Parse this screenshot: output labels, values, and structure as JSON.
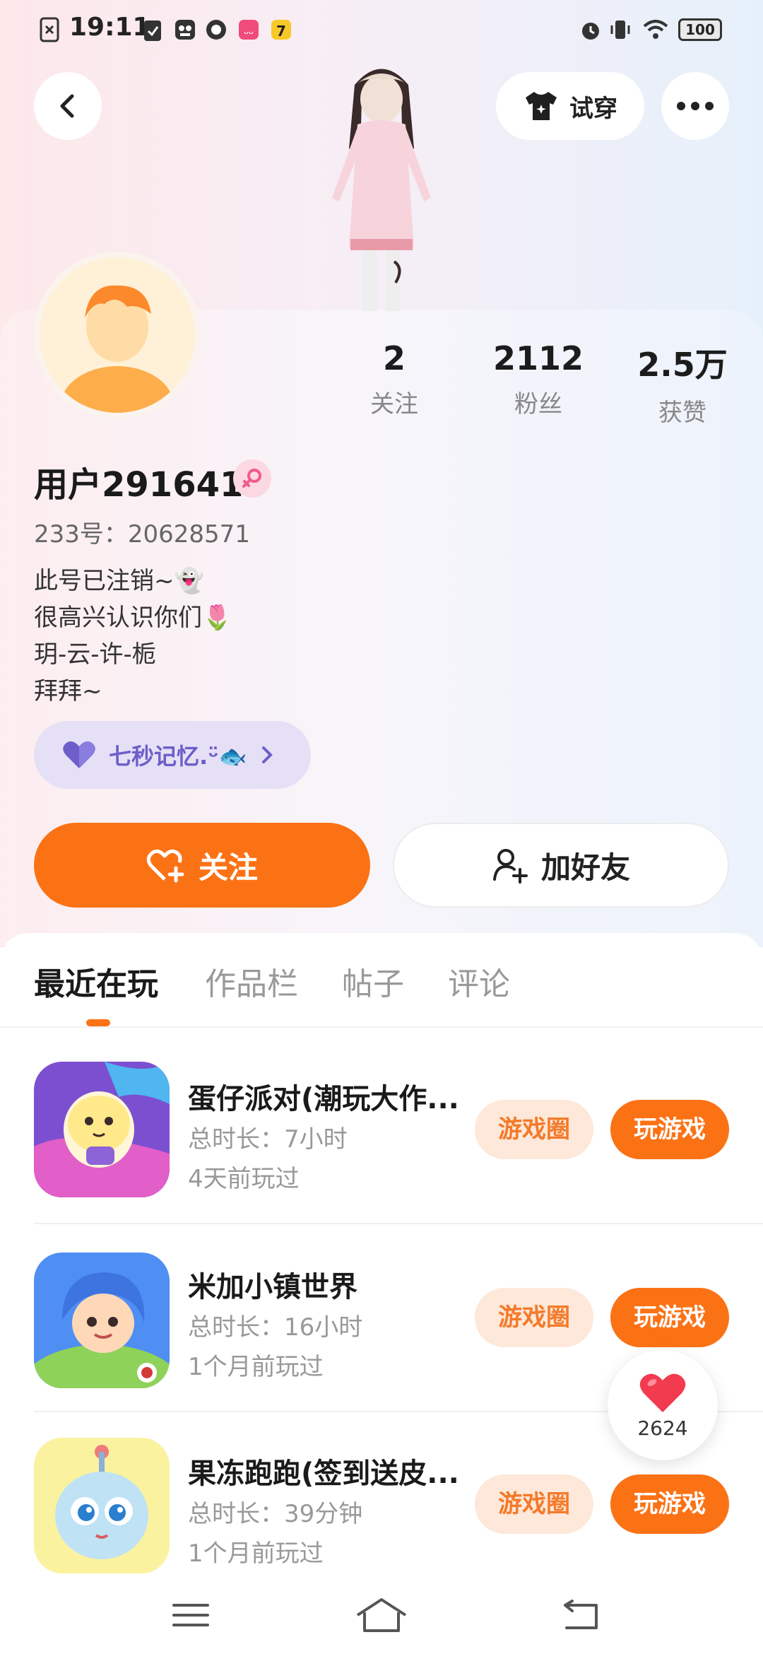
{
  "status_bar": {
    "time": "19:11",
    "battery": "100",
    "icons": [
      "sim-off-icon",
      "clipboard-icon",
      "app-icon",
      "app-icon",
      "app-icon",
      "app-icon",
      "alarm-icon",
      "vibrate-icon",
      "wifi-icon",
      "battery-icon"
    ]
  },
  "top_bar": {
    "try_on_label": "试穿",
    "icons": [
      "back-arrow-icon",
      "tshirt-icon",
      "more-icon"
    ]
  },
  "profile": {
    "username": "用户291641",
    "id_line": "233号：20628571",
    "bio": [
      "此号已注销~👻",
      "很高兴认识你们🌷",
      "玥-云-许-栀",
      "拜拜~"
    ],
    "gender": "female",
    "stats": [
      {
        "value": "2",
        "label": "关注"
      },
      {
        "value": "2112",
        "label": "粉丝"
      },
      {
        "value": "2.5万",
        "label": "获赞"
      }
    ],
    "group_label": "七秒记忆.ᵕ̈🐟",
    "follow_label": "关注",
    "add_friend_label": "加好友"
  },
  "tabs": [
    {
      "label": "最近在玩",
      "active": true
    },
    {
      "label": "作品栏",
      "active": false
    },
    {
      "label": "帖子",
      "active": false
    },
    {
      "label": "评论",
      "active": false
    }
  ],
  "games": [
    {
      "title": "蛋仔派对(潮玩大作...",
      "duration": "总时长：7小时",
      "last_played": "4天前玩过",
      "circle_label": "游戏圈",
      "play_label": "玩游戏"
    },
    {
      "title": "米加小镇世界",
      "duration": "总时长：16小时",
      "last_played": "1个月前玩过",
      "circle_label": "游戏圈",
      "play_label": "玩游戏"
    },
    {
      "title": "果冻跑跑(签到送皮...",
      "duration": "总时长：39分钟",
      "last_played": "1个月前玩过",
      "circle_label": "游戏圈",
      "play_label": "玩游戏"
    }
  ],
  "like_float": {
    "count": "2624"
  },
  "colors": {
    "accent": "#fb7215",
    "accent_light": "#fde8d9",
    "group_bg": "#e6e0f6",
    "group_text": "#6d5ec9"
  }
}
